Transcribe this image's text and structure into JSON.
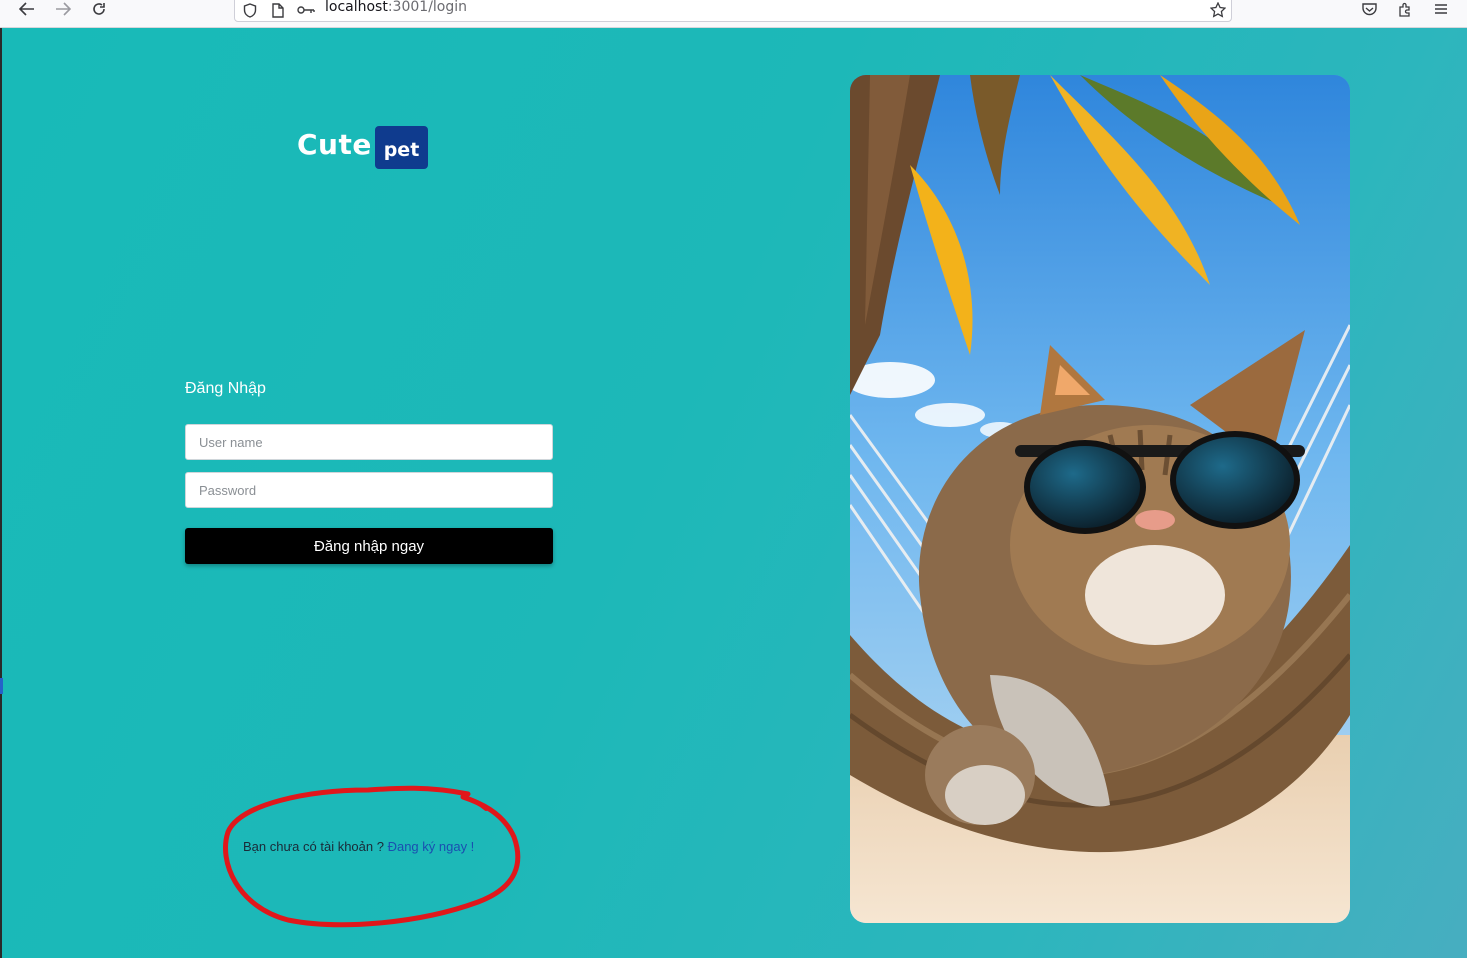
{
  "browser": {
    "url_host": "localhost",
    "url_rest": ":3001/login"
  },
  "logo": {
    "text": "Cute",
    "badge": "pet"
  },
  "login": {
    "title": "Đăng Nhập",
    "username_placeholder": "User name",
    "password_placeholder": "Password",
    "submit_label": "Đăng nhập ngay"
  },
  "signup": {
    "prompt": "Bạn chưa có tài khoản ? ",
    "link_label": "Đang ký ngay !"
  },
  "colors": {
    "background": "#1db8b8",
    "badge": "#0f3b8e",
    "button": "#000000",
    "link": "#1a4fb0",
    "annotation": "#e0171b"
  }
}
